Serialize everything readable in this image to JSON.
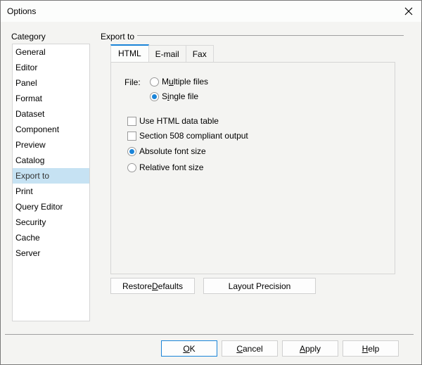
{
  "window": {
    "title": "Options",
    "close_icon": "close-icon"
  },
  "category": {
    "label": "Category",
    "selected_index": 8,
    "items": [
      {
        "label": "General"
      },
      {
        "label": "Editor"
      },
      {
        "label": "Panel"
      },
      {
        "label": "Format"
      },
      {
        "label": "Dataset"
      },
      {
        "label": "Component"
      },
      {
        "label": "Preview"
      },
      {
        "label": "Catalog"
      },
      {
        "label": "Export to"
      },
      {
        "label": "Print"
      },
      {
        "label": "Query Editor"
      },
      {
        "label": "Security"
      },
      {
        "label": "Cache"
      },
      {
        "label": "Server"
      }
    ]
  },
  "export": {
    "group_label": "Export to",
    "tabs": [
      {
        "label": "HTML",
        "active": true
      },
      {
        "label": "E-mail",
        "active": false
      },
      {
        "label": "Fax",
        "active": false
      }
    ],
    "file_label": "File:",
    "file_options": [
      {
        "pre": "M",
        "mnemonic": "u",
        "post": "ltiple files",
        "selected": false
      },
      {
        "pre": "S",
        "mnemonic": "i",
        "post": "ngle file",
        "selected": true
      }
    ],
    "checkboxes": [
      {
        "label": "Use HTML data table",
        "checked": false
      },
      {
        "label": "Section 508 compliant output",
        "checked": false
      }
    ],
    "font_size_options": [
      {
        "label": "Absolute font size",
        "selected": true
      },
      {
        "label": "Relative font size",
        "selected": false
      }
    ],
    "restore_defaults": {
      "pre": "Restore ",
      "mnemonic": "D",
      "post": "efaults"
    },
    "layout_precision": "Layout Precision"
  },
  "footer": {
    "ok": {
      "pre": "",
      "mnemonic": "O",
      "post": "K"
    },
    "cancel": {
      "pre": "",
      "mnemonic": "C",
      "post": "ancel"
    },
    "apply": {
      "pre": "",
      "mnemonic": "A",
      "post": "pply"
    },
    "help": {
      "pre": "",
      "mnemonic": "H",
      "post": "elp"
    }
  },
  "colors": {
    "accent": "#1a84d8",
    "selection": "#c6e2f3",
    "dialog_bg": "#f4f4f2"
  }
}
